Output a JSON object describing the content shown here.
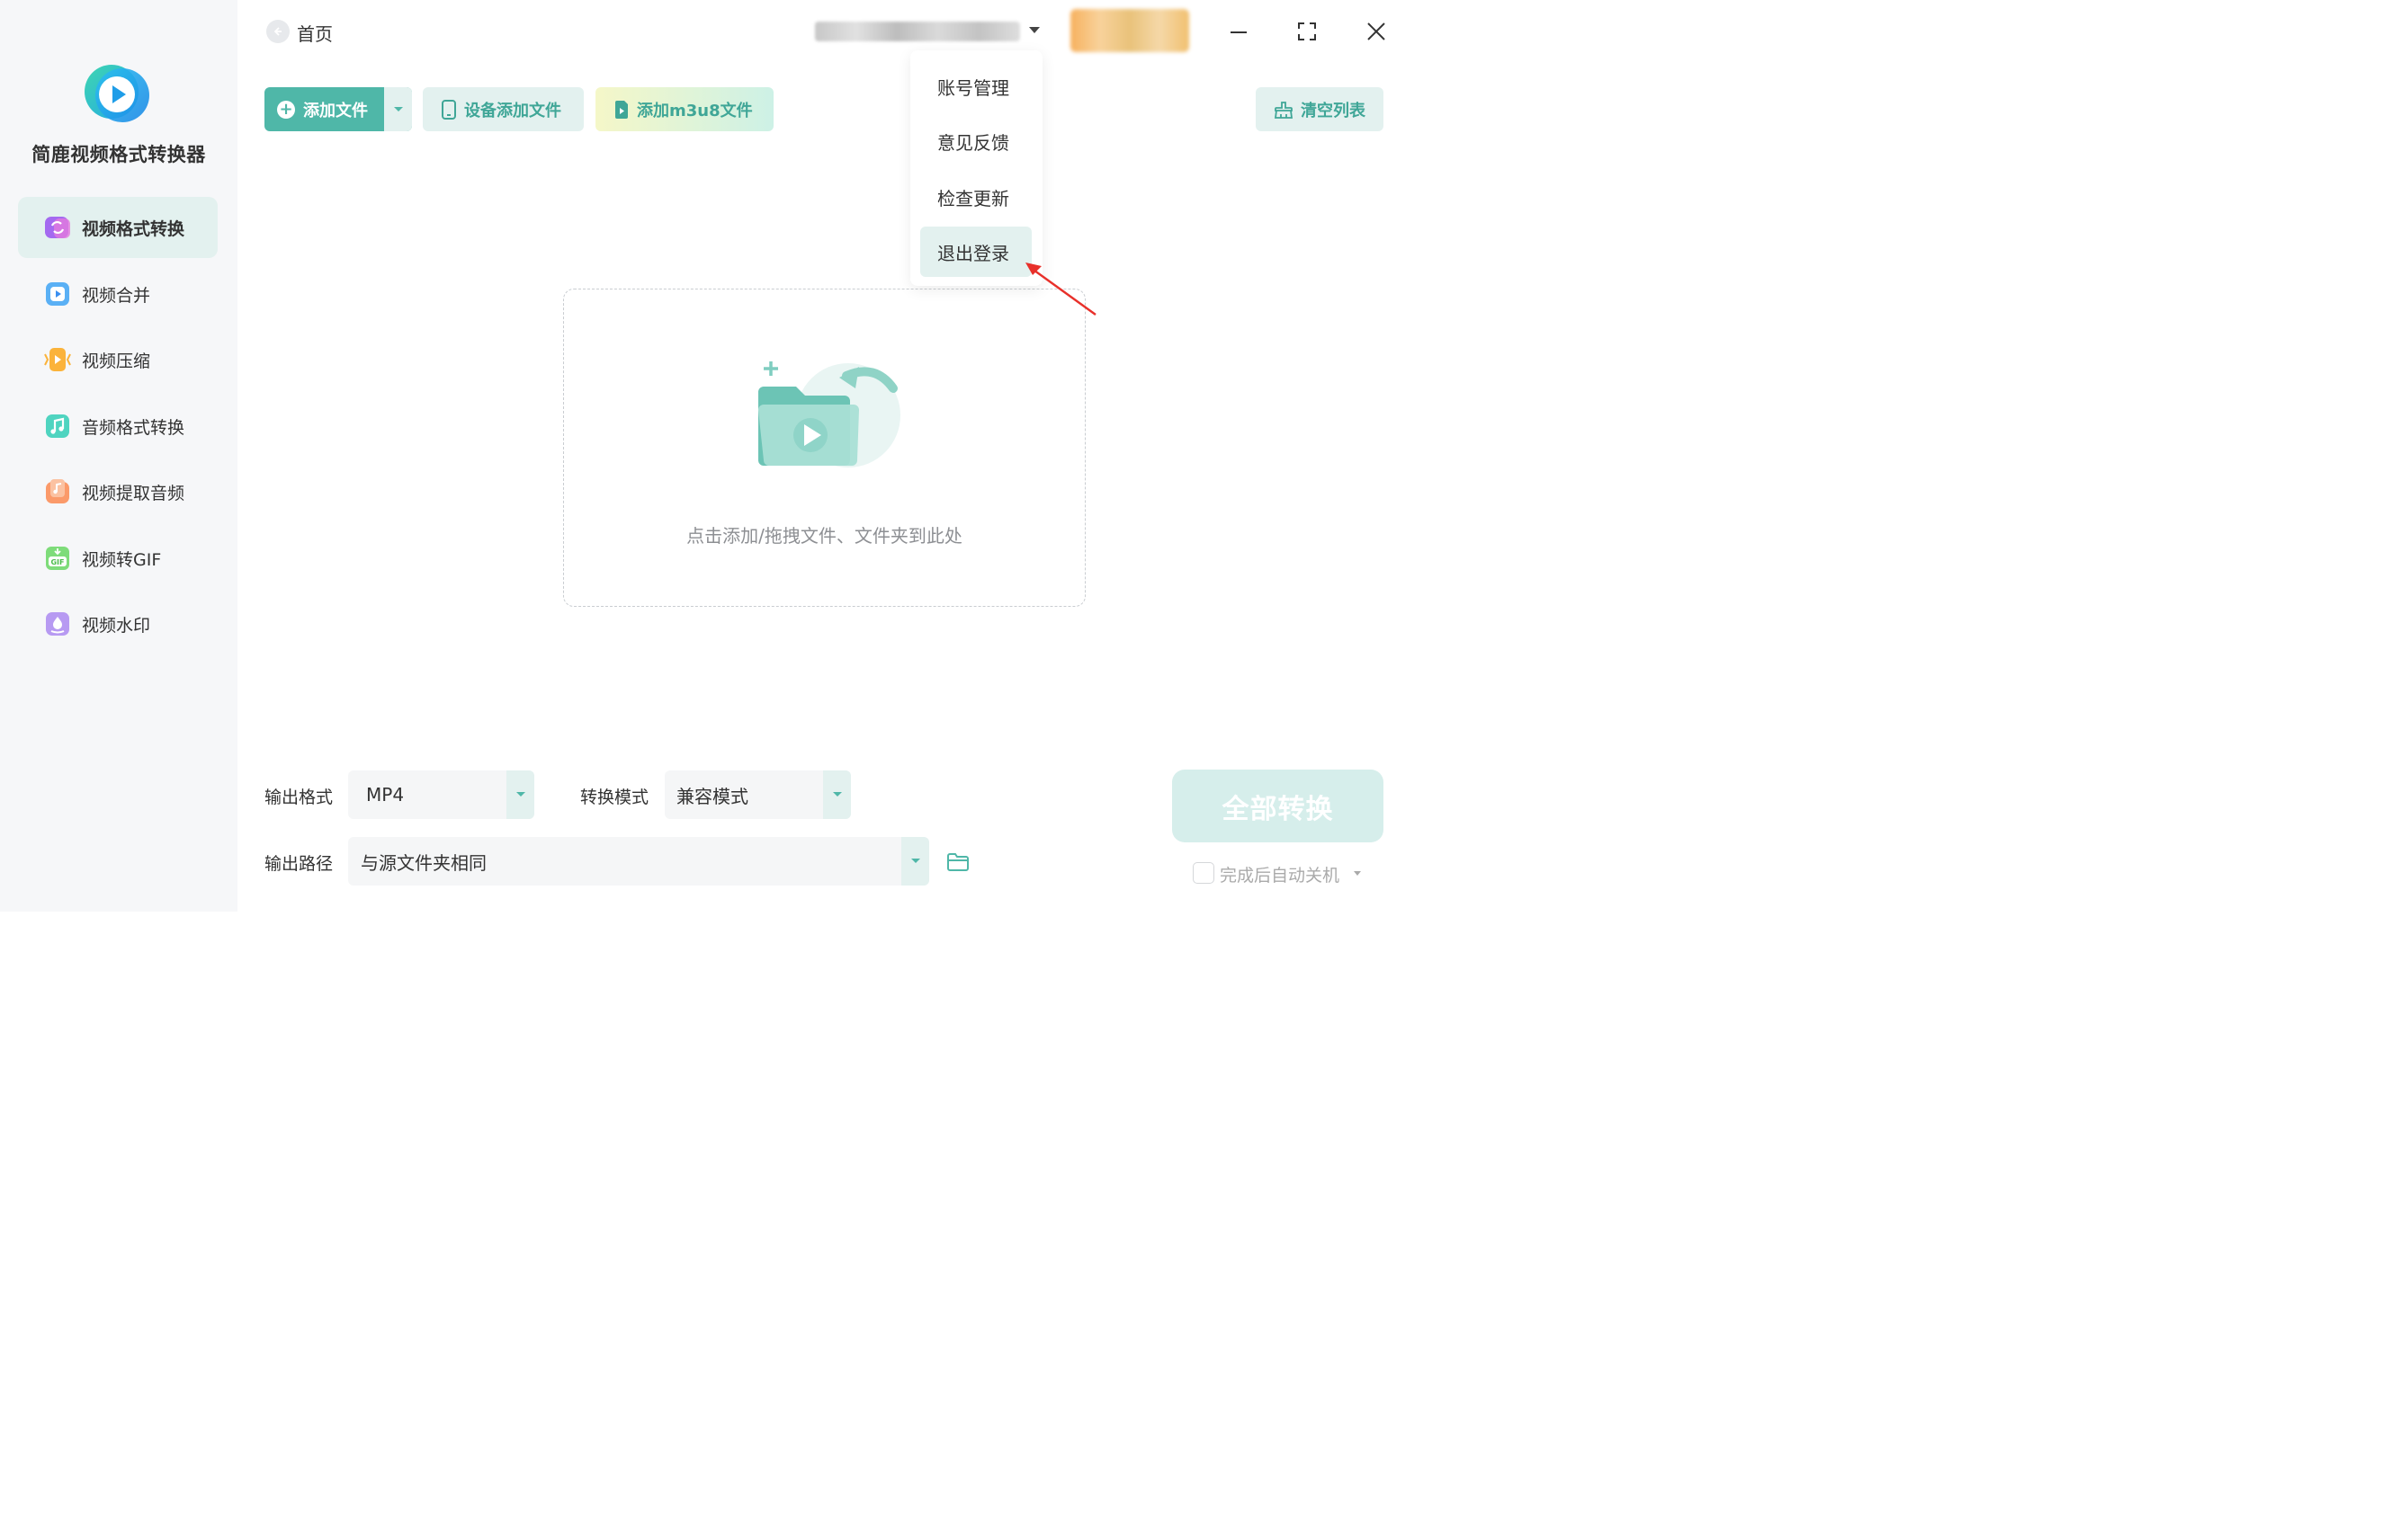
{
  "app": {
    "name": "简鹿视频格式转换器"
  },
  "sidebar": {
    "items": [
      {
        "label": "视频格式转换",
        "icon": "video-convert-icon",
        "active": true
      },
      {
        "label": "视频合并",
        "icon": "video-merge-icon"
      },
      {
        "label": "视频压缩",
        "icon": "video-compress-icon"
      },
      {
        "label": "音频格式转换",
        "icon": "audio-convert-icon"
      },
      {
        "label": "视频提取音频",
        "icon": "extract-audio-icon"
      },
      {
        "label": "视频转GIF",
        "icon": "gif-icon"
      },
      {
        "label": "视频水印",
        "icon": "watermark-icon"
      }
    ]
  },
  "header": {
    "home_label": "首页"
  },
  "toolbar": {
    "add_file": "添加文件",
    "device_add": "设备添加文件",
    "add_m3u8": "添加m3u8文件",
    "clear_list": "清空列表"
  },
  "account_menu": {
    "items": [
      "账号管理",
      "意见反馈",
      "检查更新",
      "退出登录"
    ],
    "hovered_index": 3
  },
  "dropzone": {
    "hint": "点击添加/拖拽文件、文件夹到此处"
  },
  "settings": {
    "output_format_label": "输出格式",
    "output_format_value": "MP4",
    "convert_mode_label": "转换模式",
    "convert_mode_value": "兼容模式",
    "output_path_label": "输出路径",
    "output_path_value": "与源文件夹相同"
  },
  "actions": {
    "convert_all": "全部转换",
    "shutdown_after": "完成后自动关机"
  },
  "colors": {
    "accent": "#4fb7a8",
    "accent_light": "#e3f1ef",
    "sidebar_bg": "#f6f7f9",
    "annotation_arrow": "#e8302a"
  }
}
